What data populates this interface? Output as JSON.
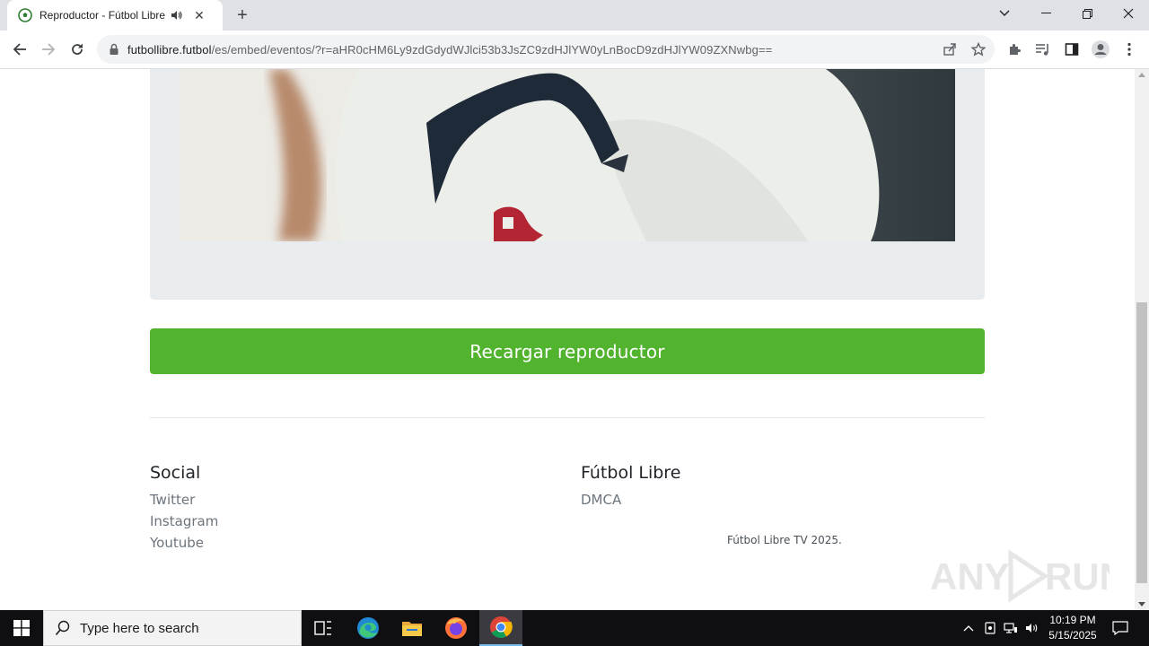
{
  "browser": {
    "tab_title": "Reproductor - Fútbol Libre TV",
    "url_host": "futbollibre.futbol",
    "url_path": "/es/embed/eventos/?r=aHR0cHM6Ly9zdGdydWJlci53b3JsZC9zdHJlYW0yLnBocD9zdHJlYW09ZXNwbg==",
    "new_tab_symbol": "+",
    "close_symbol": "✕"
  },
  "page": {
    "reload_button": "Recargar reproductor",
    "footer": {
      "social_heading": "Social",
      "social_links": [
        "Twitter",
        "Instagram",
        "Youtube"
      ],
      "brand_heading": "Fútbol Libre",
      "brand_links": [
        "DMCA"
      ],
      "copyright": "Fútbol Libre TV 2025."
    }
  },
  "taskbar": {
    "search_placeholder": "Type here to search",
    "time": "10:19 PM",
    "date": "5/15/2025"
  },
  "colors": {
    "accent_green": "#52b32f",
    "tab_strip": "#dee1e6",
    "taskbar": "#0f0f12"
  },
  "icons": [
    "soccer-ball-icon",
    "speaker-icon",
    "close-icon",
    "plus-icon",
    "back-arrow-icon",
    "forward-arrow-icon",
    "reload-icon",
    "lock-icon",
    "share-icon",
    "star-icon",
    "extensions-icon",
    "media-icon",
    "side-panel-icon",
    "profile-icon",
    "menu-icon",
    "windows-start-icon",
    "search-icon",
    "task-view-icon",
    "edge-icon",
    "file-explorer-icon",
    "firefox-icon",
    "chrome-icon",
    "notification-icon"
  ],
  "watermark_text": "ANY RUN"
}
